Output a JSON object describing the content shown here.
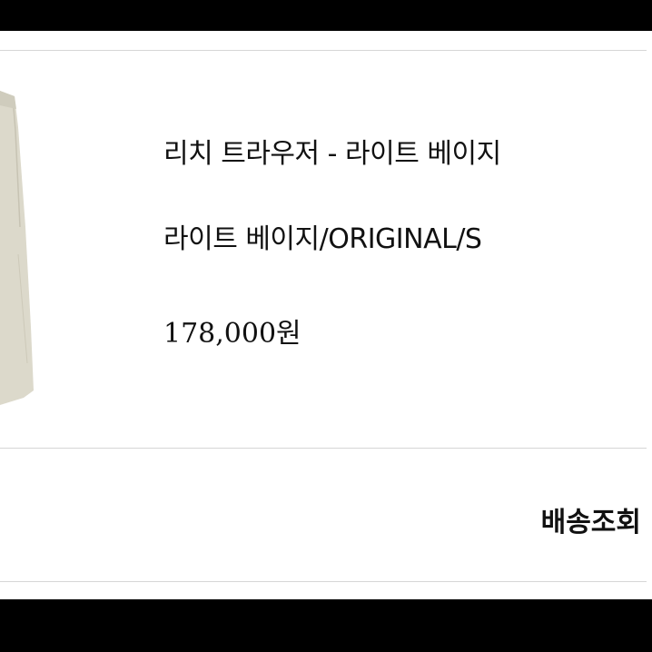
{
  "product": {
    "name": "리치 트라우저 - 라이트 베이지",
    "option": "라이트 베이지/ORIGINAL/S",
    "price": "178,000원",
    "image_color": "#d9d6c8"
  },
  "actions": {
    "tracking_label": "배송조회"
  },
  "colors": {
    "background": "#000000",
    "card": "#ffffff",
    "divider": "#d6d6d6",
    "text": "#111111"
  }
}
